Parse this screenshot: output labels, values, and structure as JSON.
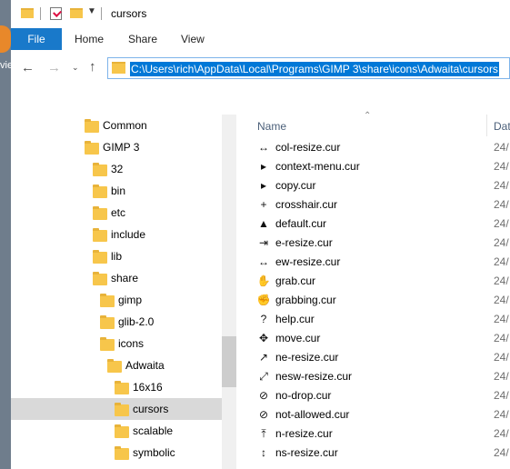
{
  "desktop": {
    "label": "vie"
  },
  "window": {
    "title": "cursors"
  },
  "ribbon": {
    "file_tab": "File",
    "tabs": [
      "Home",
      "Share",
      "View"
    ]
  },
  "nav": {
    "back_icon": "arrow-left",
    "forward_icon": "arrow-right",
    "recent_icon": "chevron-down",
    "up_icon": "arrow-up",
    "address": "C:\\Users\\rich\\AppData\\Local\\Programs\\GIMP 3\\share\\icons\\Adwaita\\cursors"
  },
  "tree": [
    {
      "label": "Common",
      "depth": 0
    },
    {
      "label": "GIMP 3",
      "depth": 0
    },
    {
      "label": "32",
      "depth": 1
    },
    {
      "label": "bin",
      "depth": 1
    },
    {
      "label": "etc",
      "depth": 1
    },
    {
      "label": "include",
      "depth": 1
    },
    {
      "label": "lib",
      "depth": 1
    },
    {
      "label": "share",
      "depth": 1
    },
    {
      "label": "gimp",
      "depth": 2
    },
    {
      "label": "glib-2.0",
      "depth": 2
    },
    {
      "label": "icons",
      "depth": 2
    },
    {
      "label": "Adwaita",
      "depth": 3
    },
    {
      "label": "16x16",
      "depth": 4
    },
    {
      "label": "cursors",
      "depth": 4,
      "selected": true
    },
    {
      "label": "scalable",
      "depth": 4
    },
    {
      "label": "symbolic",
      "depth": 4
    }
  ],
  "list": {
    "name_header": "Name",
    "date_header": "Dat",
    "files": [
      {
        "name": "col-resize.cur",
        "icon": "↔",
        "date": "24/"
      },
      {
        "name": "context-menu.cur",
        "icon": "▸",
        "date": "24/"
      },
      {
        "name": "copy.cur",
        "icon": "▸",
        "date": "24/"
      },
      {
        "name": "crosshair.cur",
        "icon": "+",
        "date": "24/"
      },
      {
        "name": "default.cur",
        "icon": "▲",
        "date": "24/"
      },
      {
        "name": "e-resize.cur",
        "icon": "⇥",
        "date": "24/"
      },
      {
        "name": "ew-resize.cur",
        "icon": "↔",
        "date": "24/"
      },
      {
        "name": "grab.cur",
        "icon": "✋",
        "date": "24/"
      },
      {
        "name": "grabbing.cur",
        "icon": "✊",
        "date": "24/"
      },
      {
        "name": "help.cur",
        "icon": "?",
        "date": "24/"
      },
      {
        "name": "move.cur",
        "icon": "✥",
        "date": "24/"
      },
      {
        "name": "ne-resize.cur",
        "icon": "↗",
        "date": "24/"
      },
      {
        "name": "nesw-resize.cur",
        "icon": "⤢",
        "date": "24/"
      },
      {
        "name": "no-drop.cur",
        "icon": "⊘",
        "date": "24/"
      },
      {
        "name": "not-allowed.cur",
        "icon": "⊘",
        "date": "24/"
      },
      {
        "name": "n-resize.cur",
        "icon": "⤒",
        "date": "24/"
      },
      {
        "name": "ns-resize.cur",
        "icon": "↕",
        "date": "24/"
      }
    ]
  },
  "colors": {
    "accent": "#1979ca",
    "selection": "#0078d7",
    "folder": "#f7c64b"
  }
}
